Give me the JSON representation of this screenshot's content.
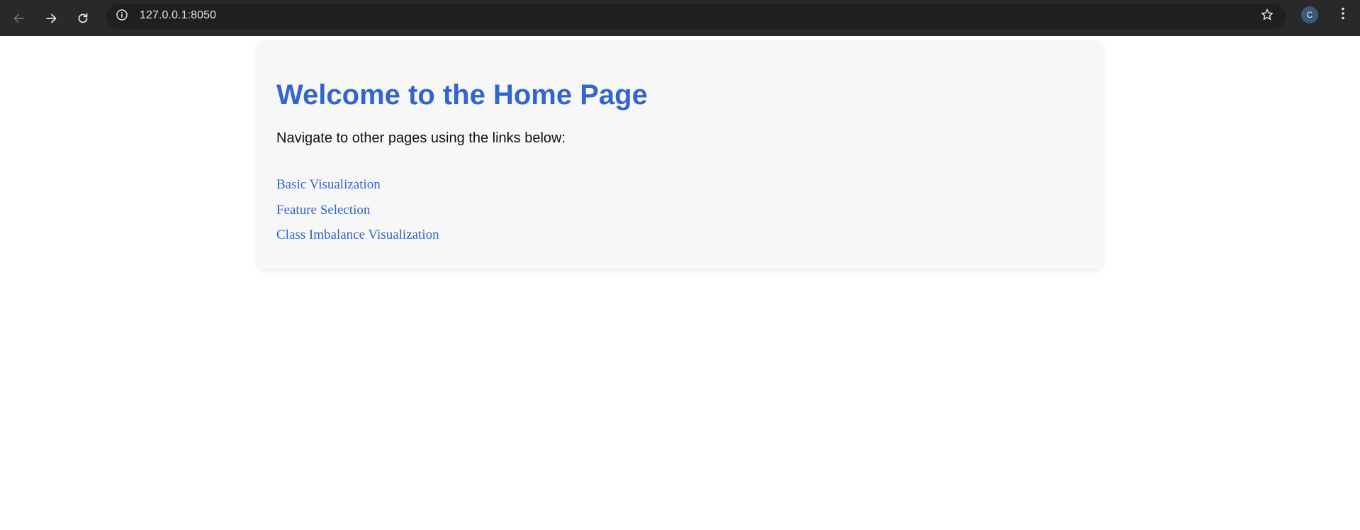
{
  "browser": {
    "url": "127.0.0.1:8050",
    "profile_initial": "C",
    "icons": {
      "back": "back-arrow-icon",
      "forward": "forward-arrow-icon",
      "reload": "reload-icon",
      "site_info": "info-icon",
      "bookmark": "star-icon",
      "menu": "kebab-menu-icon"
    }
  },
  "page": {
    "title": "Welcome to the Home Page",
    "intro": "Navigate to other pages using the links below:",
    "links": [
      {
        "label": "Basic Visualization"
      },
      {
        "label": "Feature Selection"
      },
      {
        "label": "Class Imbalance Visualization"
      }
    ]
  },
  "colors": {
    "accent": "#3366cc",
    "toolbar_bg": "#292929",
    "card_bg": "#f7f7f7"
  }
}
